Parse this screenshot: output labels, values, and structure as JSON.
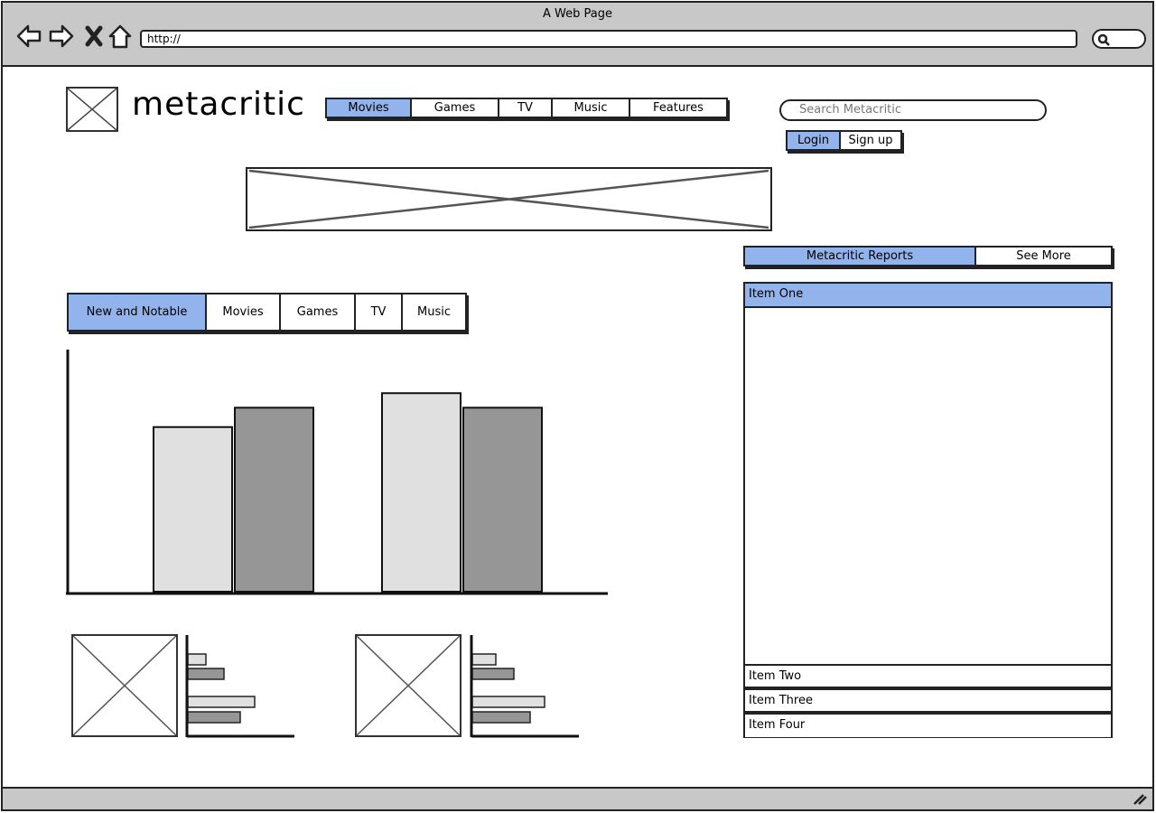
{
  "browser": {
    "title": "A Web Page",
    "url": "http://"
  },
  "site": {
    "logo_text": "metacritic",
    "search_placeholder": "Search Metacritic"
  },
  "topnav": {
    "items": [
      "Movies",
      "Games",
      "TV",
      "Music",
      "Features"
    ],
    "active_index": 0
  },
  "auth": {
    "login": "Login",
    "signup": "Sign up"
  },
  "reports": {
    "tab_active": "Metacritic Reports",
    "tab_more": "See More",
    "items": [
      "Item One",
      "Item Two",
      "Item Three",
      "Item Four"
    ],
    "selected_index": 0
  },
  "category_tabs": {
    "items": [
      "New and Notable",
      "Movies",
      "Games",
      "TV",
      "Music"
    ],
    "active_index": 0
  },
  "colors": {
    "accent": "#93b3ec",
    "light_bar": "#e0e0e0",
    "dark_bar": "#969696",
    "chrome": "#c8c8c8"
  },
  "chart_data": {
    "type": "bar",
    "categories": [
      "",
      ""
    ],
    "series": [
      {
        "values": [
          68,
          82
        ]
      },
      {
        "values": [
          76,
          76
        ]
      }
    ],
    "ylim": [
      0,
      100
    ],
    "grid": false
  },
  "mini_charts": [
    {
      "type": "bar",
      "orientation": "horizontal",
      "values": [
        10,
        20,
        37,
        29
      ]
    },
    {
      "type": "bar",
      "orientation": "horizontal",
      "values": [
        13,
        23,
        40,
        32
      ]
    }
  ]
}
